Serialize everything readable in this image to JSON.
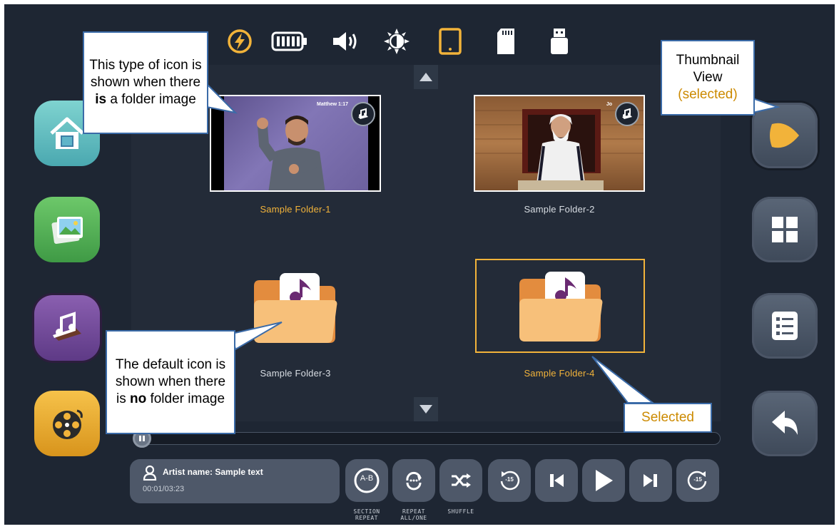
{
  "status_bar": {
    "icons": [
      "flash-icon",
      "battery-icon",
      "volume-icon",
      "brightness-icon",
      "tablet-icon",
      "sd-card-icon",
      "usb-drive-icon"
    ]
  },
  "folders": [
    {
      "label": "Sample Folder-1",
      "has_image": true,
      "highlight": true,
      "image_text": "Matthew 1:17"
    },
    {
      "label": "Sample Folder-2",
      "has_image": true,
      "highlight": false,
      "image_text": "Jo"
    },
    {
      "label": "Sample Folder-3",
      "has_image": false,
      "highlight": false
    },
    {
      "label": "Sample Folder-4",
      "has_image": false,
      "highlight": true,
      "selected": true
    }
  ],
  "left_nav": [
    "home-button",
    "photos-button",
    "audio-bible-button",
    "video-button"
  ],
  "right_nav": [
    "thumbnail-view-button",
    "grid-view-button",
    "list-view-button",
    "back-button"
  ],
  "player": {
    "artist": "Artist name: Sample text",
    "time": "00:01/03:23",
    "progress": 0.0,
    "labels": {
      "section_repeat": "SECTION\nREPEAT",
      "repeat_all": "REPEAT\nALL/ONE",
      "shuffle": "SHUFFLE"
    },
    "ab_text": "A-B",
    "rewind_text": "-15",
    "forward_text": "-15"
  },
  "callouts": {
    "folder_image_pre": "This type of icon is shown when there ",
    "folder_image_bold": "is",
    "folder_image_post": " a folder image",
    "default_pre": "The default icon is shown when there is ",
    "default_bold": "no",
    "default_post": " folder image",
    "thumbnail_title": "Thumbnail View",
    "thumbnail_selected": "(selected)",
    "selected": "Selected"
  },
  "colors": {
    "accent": "#f2b33a",
    "background": "#1e2633",
    "panel": "#232b38",
    "callout_border": "#3b6ba8"
  }
}
